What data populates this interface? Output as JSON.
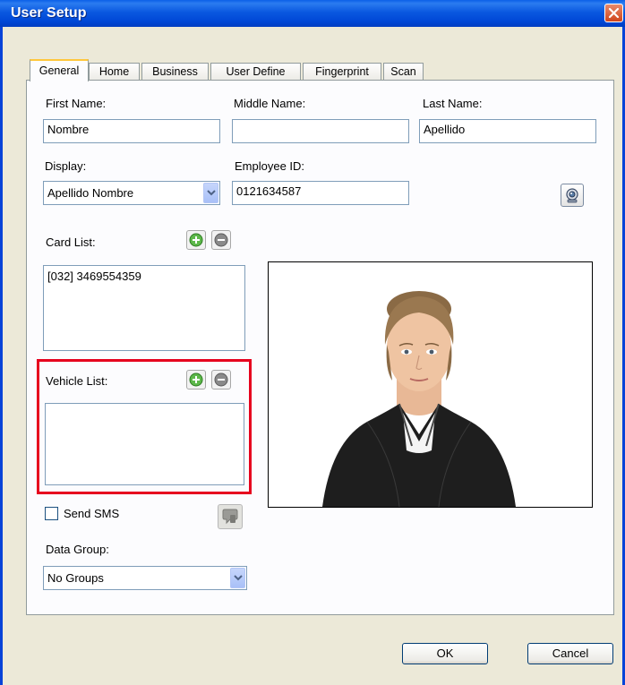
{
  "window": {
    "title": "User Setup"
  },
  "tabs": [
    "General",
    "Home",
    "Business",
    "User Define",
    "Fingerprint",
    "Scan"
  ],
  "general": {
    "first_name": {
      "label": "First Name:",
      "value": "Nombre"
    },
    "middle_name": {
      "label": "Middle Name:",
      "value": ""
    },
    "last_name": {
      "label": "Last Name:",
      "value": "Apellido"
    },
    "display": {
      "label": "Display:",
      "value": "Apellido Nombre"
    },
    "employee_id": {
      "label": "Employee ID:",
      "value": "0121634587"
    },
    "card_list": {
      "label": "Card List:",
      "items": [
        "[032] 3469554359"
      ]
    },
    "vehicle_list": {
      "label": "Vehicle List:",
      "items": []
    },
    "send_sms": {
      "label": "Send SMS",
      "checked": false
    },
    "data_group": {
      "label": "Data Group:",
      "value": "No Groups"
    }
  },
  "buttons": {
    "ok": "OK",
    "cancel": "Cancel"
  },
  "colors": {
    "title_bar": "#0a58e0",
    "highlight_border": "#e6001e",
    "active_tab_accent": "#ffc73c"
  }
}
